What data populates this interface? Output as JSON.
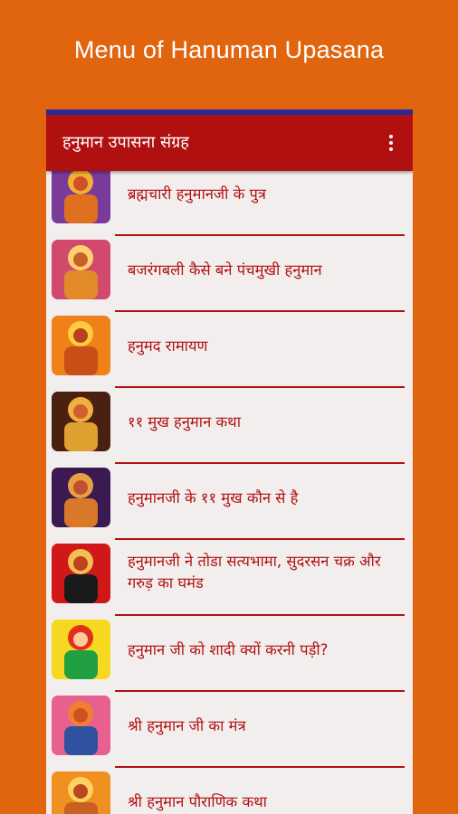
{
  "promo": {
    "title": "Menu of Hanuman Upasana"
  },
  "toolbar": {
    "title": "हनुमान उपासना संग्रह",
    "menu_icon": "more-vert-icon"
  },
  "colors": {
    "background": "#e0650e",
    "toolbar": "#b01010",
    "text": "#b01010",
    "list_bg": "#f3eeee"
  },
  "list": [
    {
      "label": "ब्रह्मचारी हनुमानजी के पुत्र",
      "icon": "hanuman-image"
    },
    {
      "label": "बजरंगबली कैसे बने पंचमुखी हनुमान",
      "icon": "hanuman-image"
    },
    {
      "label": "हनुमद रामायण",
      "icon": "hanuman-image"
    },
    {
      "label": "११ मुख हनुमान कथा",
      "icon": "hanuman-image"
    },
    {
      "label": "हनुमानजी के ११ मुख कौन से है",
      "icon": "hanuman-image"
    },
    {
      "label": "हनुमानजी ने तोडा सत्यभामा, सुदरसन चक्र और गरुड़ का घमंड",
      "icon": "hanuman-image"
    },
    {
      "label": "हनुमान जी को शादी क्यों करनी पड़ी?",
      "icon": "hanuman-image"
    },
    {
      "label": "श्री हनुमान जी का मंत्र",
      "icon": "hanuman-image"
    },
    {
      "label": "श्री हनुमान पौराणिक कथा",
      "icon": "hanuman-image"
    }
  ]
}
